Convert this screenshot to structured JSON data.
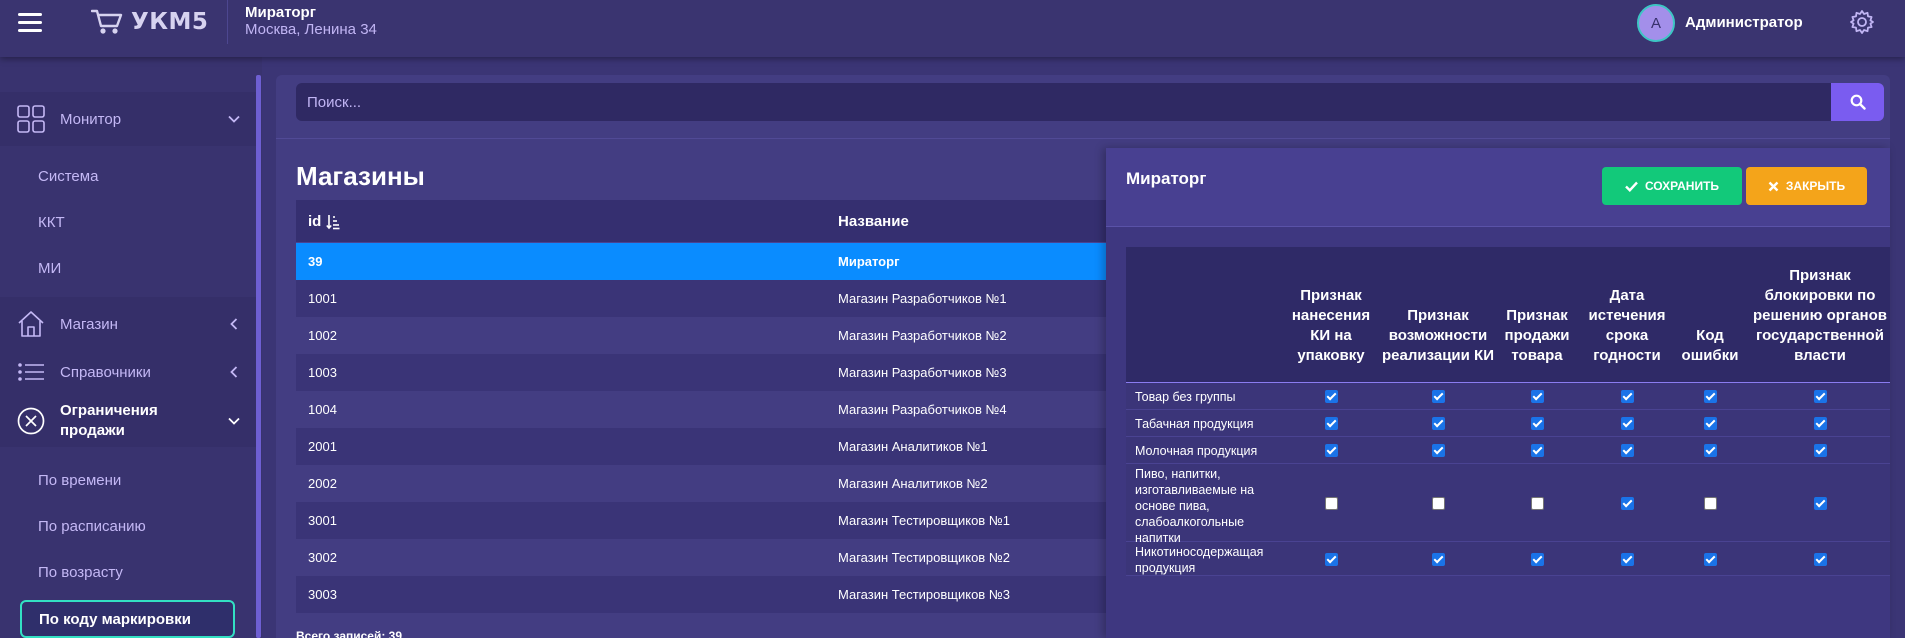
{
  "app": {
    "logo_text": "УКМ5"
  },
  "header": {
    "store_name": "Мираторг",
    "store_address": "Москва, Ленина 34",
    "avatar_letter": "А",
    "user_name": "Администратор"
  },
  "sidebar": {
    "groups": [
      {
        "label": "Монитор",
        "icon": "monitor-grid-icon",
        "expanded": true
      },
      {
        "label": "Магазин",
        "icon": "home-icon",
        "expanded": false
      },
      {
        "label": "Справочники",
        "icon": "list-icon",
        "expanded": false
      },
      {
        "label": "Ограничения продажи",
        "icon": "forbidden-icon",
        "expanded": true
      }
    ],
    "monitor_items": [
      "Система",
      "ККТ",
      "МИ"
    ],
    "restriction_items": [
      "По времени",
      "По расписанию",
      "По возрасту"
    ],
    "active_item": "По коду маркировки"
  },
  "search": {
    "placeholder": "Поиск..."
  },
  "page": {
    "title": "Магазины",
    "total_label": "Всего записей: 39"
  },
  "stores_table": {
    "columns": [
      "id",
      "Название"
    ],
    "selected_id": "39",
    "rows": [
      {
        "id": "39",
        "name": "Мираторг"
      },
      {
        "id": "1001",
        "name": "Магазин Разработчиков №1"
      },
      {
        "id": "1002",
        "name": "Магазин Разработчиков №2"
      },
      {
        "id": "1003",
        "name": "Магазин Разработчиков №3"
      },
      {
        "id": "1004",
        "name": "Магазин Разработчиков №4"
      },
      {
        "id": "2001",
        "name": "Магазин Аналитиков №1"
      },
      {
        "id": "2002",
        "name": "Магазин Аналитиков №2"
      },
      {
        "id": "3001",
        "name": "Магазин Тестировщиков №1"
      },
      {
        "id": "3002",
        "name": "Магазин Тестировщиков №2"
      },
      {
        "id": "3003",
        "name": "Магазин Тестировщиков №3"
      }
    ]
  },
  "detail": {
    "title": "Мираторг",
    "save_label": "СОХРАНИТЬ",
    "close_label": "ЗАКРЫТЬ",
    "columns": [
      "Признак нанесения КИ на упаковку",
      "Признак возможности реализации КИ",
      "Признак продажи товара",
      "Дата истечения срока годности",
      "Код ошибки",
      "Признак блокировки по решению органов государственной власти"
    ],
    "rows": [
      {
        "category": "Товар без группы",
        "flags": [
          true,
          true,
          true,
          true,
          true,
          true
        ]
      },
      {
        "category": "Табачная продукция",
        "flags": [
          true,
          true,
          true,
          true,
          true,
          true
        ]
      },
      {
        "category": "Молочная продукция",
        "flags": [
          true,
          true,
          true,
          true,
          true,
          true
        ]
      },
      {
        "category": "Пиво, напитки, изготавливаемые на основе пива, слабоалкогольные напитки",
        "flags": [
          false,
          false,
          false,
          true,
          false,
          true
        ]
      },
      {
        "category": "Никотиносодержащая продукция",
        "flags": [
          true,
          true,
          true,
          true,
          true,
          true
        ]
      }
    ]
  },
  "colors": {
    "background": "#3b3575",
    "selected_row": "#0a8cff",
    "save_button": "#12c97a",
    "close_button": "#f4a41a",
    "search_button": "#7a5cf0",
    "active_border": "#33e0c3"
  }
}
